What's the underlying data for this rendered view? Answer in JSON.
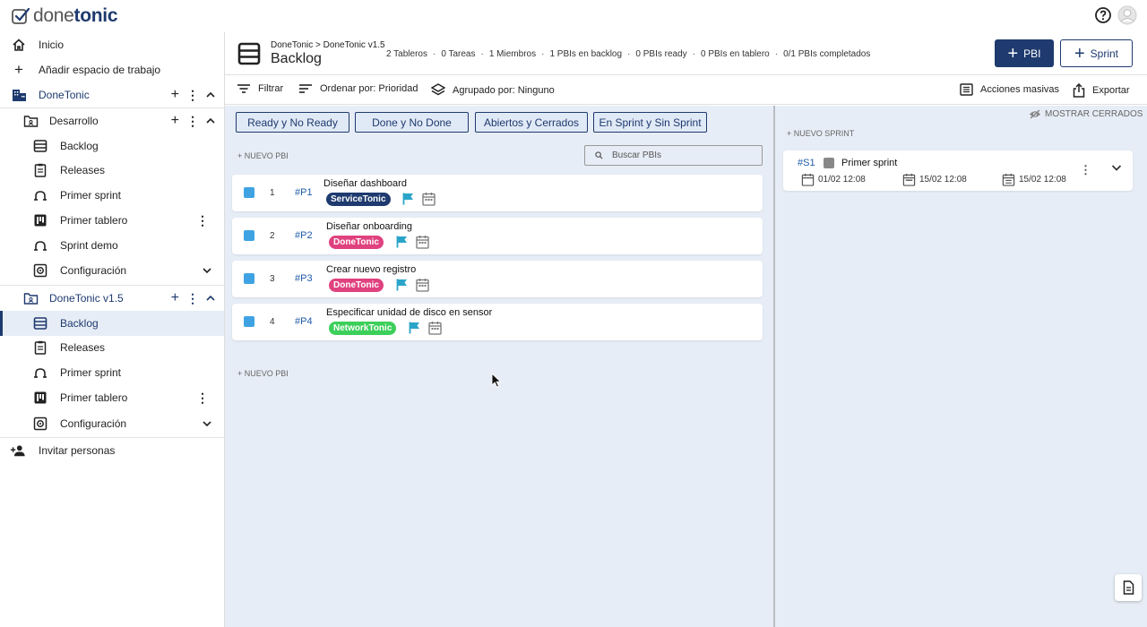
{
  "app": {
    "logo_part1": "done",
    "logo_part2": "tonic",
    "help_icon": "help-circle-icon",
    "user_icon": "user-avatar-icon"
  },
  "sidebar": {
    "inicio": "Inicio",
    "add_workspace": "Añadir espacio de trabajo",
    "workspace": "DoneTonic",
    "project1": {
      "name": "Desarrollo",
      "items": [
        "Backlog",
        "Releases",
        "Primer sprint",
        "Primer tablero",
        "Sprint demo",
        "Configuración"
      ]
    },
    "project2": {
      "name": "DoneTonic v1.5",
      "items": [
        "Backlog",
        "Releases",
        "Primer sprint",
        "Primer tablero",
        "Configuración"
      ]
    },
    "invite": "Invitar personas"
  },
  "header": {
    "breadcrumb_parent": "DoneTonic",
    "breadcrumb_sep": ">",
    "breadcrumb_child": "DoneTonic v1.5",
    "title": "Backlog",
    "stats": [
      "2 Tableros",
      "0 Tareas",
      "1 Miembros",
      "1 PBIs en backlog",
      "0 PBIs ready",
      "0 PBIs en tablero",
      "0/1 PBIs completados"
    ],
    "btn_pbi": "PBI",
    "btn_sprint": "Sprint"
  },
  "toolbar": {
    "filter": "Filtrar",
    "sort": "Ordenar por: Prioridad",
    "group": "Agrupado por: Ninguno",
    "bulk": "Acciones masivas",
    "export": "Exportar"
  },
  "filters": [
    "Ready y No Ready",
    "Done y No Done",
    "Abiertos y Cerrados",
    "En Sprint y Sin Sprint"
  ],
  "backlog": {
    "new_pbi": "+ NUEVO PBI",
    "search_placeholder": "Buscar PBIs",
    "items": [
      {
        "num": "1",
        "id": "#P1",
        "title": "Diseñar dashboard",
        "tag": "ServiceTonic",
        "tag_color": "#1e3a6e"
      },
      {
        "num": "2",
        "id": "#P2",
        "title": "Diseñar onboarding",
        "tag": "DoneTonic",
        "tag_color": "#e0417f"
      },
      {
        "num": "3",
        "id": "#P3",
        "title": "Crear nuevo registro",
        "tag": "DoneTonic",
        "tag_color": "#e0417f"
      },
      {
        "num": "4",
        "id": "#P4",
        "title": "Especificar unidad de disco en sensor",
        "tag": "NetworkTonic",
        "tag_color": "#3ccf5a"
      }
    ],
    "flag_color": "#2aa5c9"
  },
  "sprints": {
    "show_closed": "MOSTRAR CERRADOS",
    "new_sprint": "+ NUEVO SPRINT",
    "items": [
      {
        "id": "#S1",
        "title": "Primer sprint",
        "date1": "01/02 12:08",
        "date2": "15/02 12:08",
        "date3": "15/02 12:08"
      }
    ]
  }
}
